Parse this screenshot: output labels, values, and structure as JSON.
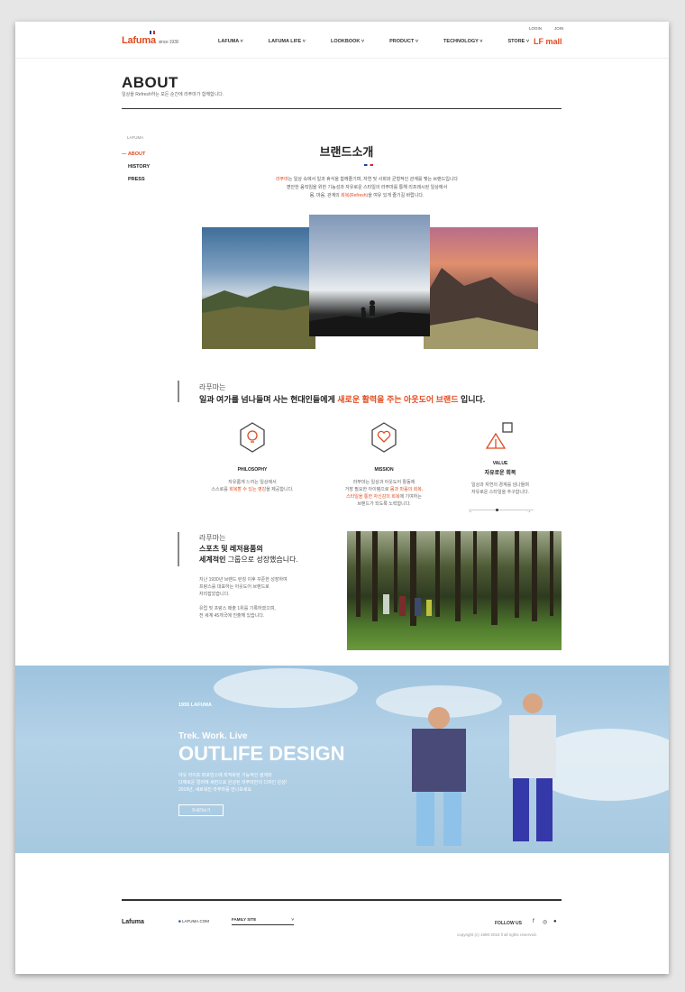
{
  "header": {
    "logo": "Lafuma",
    "logo_since": "since 1930",
    "nav": [
      "LAFUMA ˅",
      "LAFUMA LIFE ˅",
      "LOOKBOOK ˅",
      "PRODUCT ˅",
      "TECHNOLOGY ˅",
      "STORE ˅"
    ],
    "login": "LOGIN",
    "join": "JOIN",
    "mall": "LF mall"
  },
  "page": {
    "title": "ABOUT",
    "subtitle": "일상을 Refresh하는 모든 순간에 라푸마가 함께합니다."
  },
  "sidebar": {
    "heading": "LAFUMA",
    "items": [
      "ABOUT",
      "HISTORY",
      "PRESS"
    ]
  },
  "intro": {
    "title": "브랜드소개",
    "p1a": "라푸마",
    "p1b": "는 일상 속에서 일과 휴식을 함께즐기며, 자연 및 사회와 균형적인 관계를 맺는 브랜드입니다",
    "p2": "편안한 움직임을 위한 기능성과 자유로운 스타일의 라푸마를 통해 리프레시된 일상에서",
    "p3a": "몸, 마음, 관계의 ",
    "p3b": "회복(Refresh)",
    "p3c": "을 여유 있게 즐기길 바랍니다."
  },
  "slogan": {
    "line1": "라푸마는",
    "line2a": "일과 여가를 넘나들며 사는 현대인들에게 ",
    "line2b": "새로운 활력을 주는 아웃도어 브랜드",
    "line2c": " 입니다."
  },
  "values": [
    {
      "label": "PHILOSOPHY",
      "text1": "자유롭게 느끼는 일상에서",
      "text2a": "스스로를 ",
      "text2b": "회복할 수 있는 영감",
      "text2c": "을 제공합니다."
    },
    {
      "label": "MISSION",
      "text1": "라푸마는 일상과 아웃도어 활동에",
      "text2a": "거장 필요한 아이템으로 ",
      "text2b": "몸과 마음의 회복,",
      "text3a": "스타일을 통한 자신감의 회복",
      "text3b": "에 기여하는",
      "text4": "브랜드가 되도록 노력합니다."
    },
    {
      "label": "VALUE",
      "sublabel": "자유로운 회복",
      "text1": "일상과 자연의 경계를 넘나들며",
      "text2": "자유로운 스타일을 추구합니다."
    }
  ],
  "growth": {
    "line1": "라푸마는",
    "line2": "스포츠 및 레저용품의",
    "line3a": "세계적인",
    "line3b": " 그룹으로 성장했습니다.",
    "p1": "지난 1930년 브랜드 런칭 이후 꾸준한 성장하여",
    "p2": "프랑스를 대표하는 아웃도어 브랜드로",
    "p3": "자리잡았습니다.",
    "p4": "유럽 및 프랑스 매출 1위를 기록하였으며,",
    "p5": "전 세계 45개국에 진출해 있습니다."
  },
  "banner": {
    "small": "1955 LAFUMA",
    "mid": "Trek. Work. Live",
    "big": "OUTLIFE DESIGN",
    "p1": "아웃 라이프 퍼포먼스에 최적화된 기능적인 설계와",
    "p2": "다채로운 컬러에 세련으로 완성된 라푸마만의 디자인 감성!",
    "p3": "2019년, 새로워진 라푸마를 만나보세요",
    "button": "자세히보기"
  },
  "footer": {
    "logo": "Lafuma",
    "site": "LAFUMA.COM",
    "family": "FAMILY SITE",
    "follow": "FOLLOW US",
    "copyright": "copyright (c) 1990-2018 ll all rights reserved."
  }
}
